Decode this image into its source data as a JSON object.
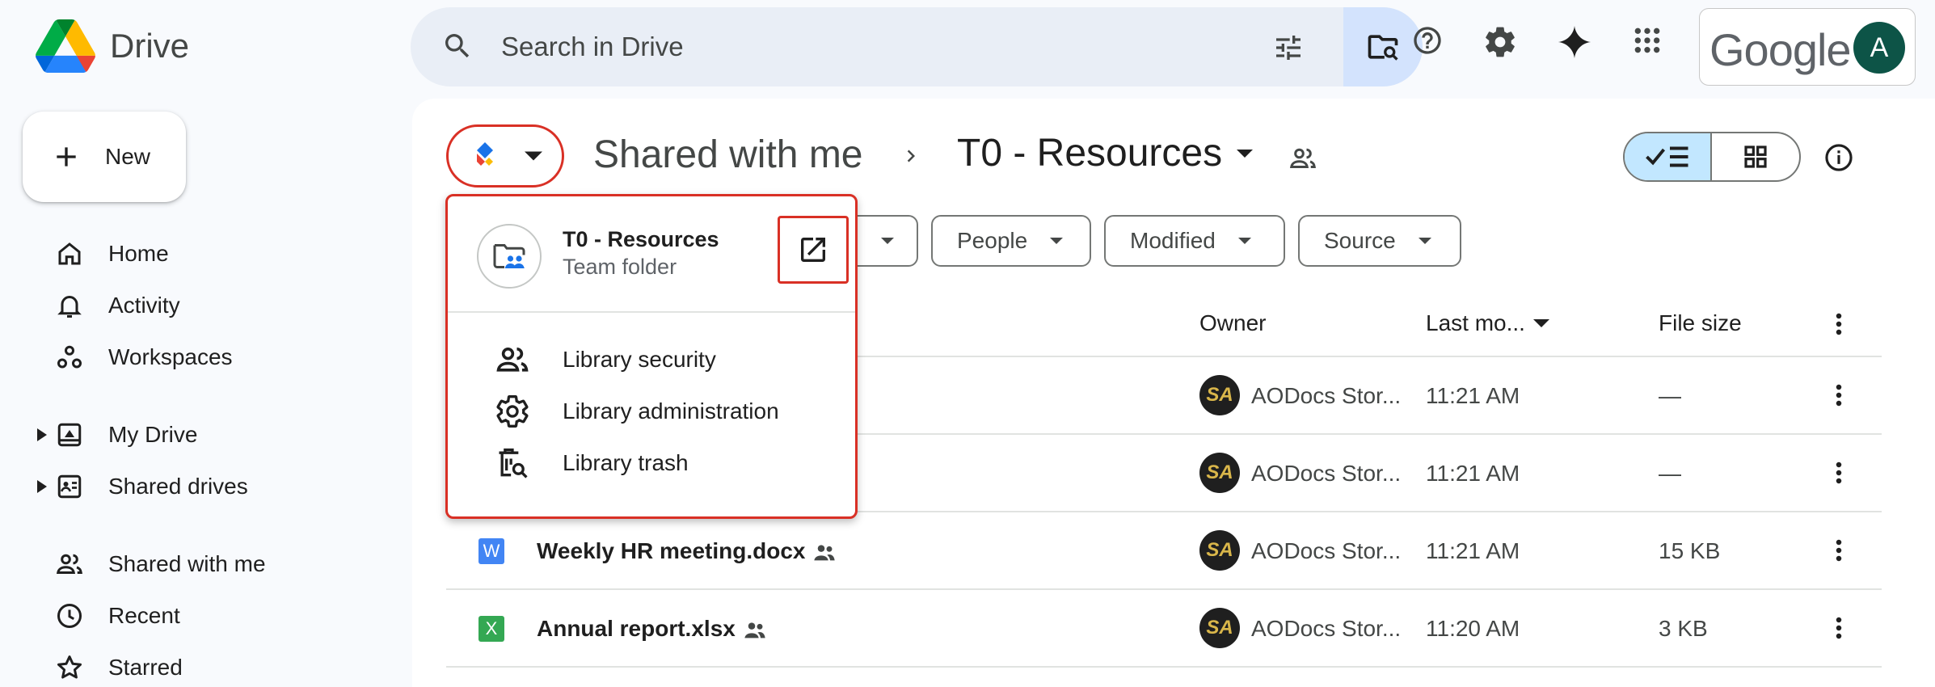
{
  "app": {
    "name": "Drive"
  },
  "search": {
    "placeholder": "Search in Drive"
  },
  "account": {
    "brand": "Google",
    "avatar_letter": "A"
  },
  "sidebar": {
    "new_label": "New",
    "items": [
      {
        "label": "Home",
        "icon": "home-icon"
      },
      {
        "label": "Activity",
        "icon": "bell-icon"
      },
      {
        "label": "Workspaces",
        "icon": "workspaces-icon"
      },
      {
        "label": "My Drive",
        "icon": "my-drive-icon"
      },
      {
        "label": "Shared drives",
        "icon": "shared-drives-icon"
      },
      {
        "label": "Shared with me",
        "icon": "people-icon"
      },
      {
        "label": "Recent",
        "icon": "clock-icon"
      },
      {
        "label": "Starred",
        "icon": "star-icon"
      }
    ]
  },
  "breadcrumb": {
    "parent": "Shared with me",
    "current": "T0 - Resources"
  },
  "filters": {
    "people": "People",
    "modified": "Modified",
    "source": "Source"
  },
  "table": {
    "headers": {
      "owner": "Owner",
      "last_modified": "Last mo...",
      "file_size": "File size"
    },
    "rows": [
      {
        "name": "",
        "owner": "AODocs Stor...",
        "modified": "11:21 AM",
        "size": "—"
      },
      {
        "name": "",
        "owner": "AODocs Stor...",
        "modified": "11:21 AM",
        "size": "—"
      },
      {
        "name": "Weekly HR meeting.docx",
        "type_letter": "W",
        "owner": "AODocs Stor...",
        "modified": "11:21 AM",
        "size": "15 KB"
      },
      {
        "name": "Annual report.xlsx",
        "type_letter": "X",
        "owner": "AODocs Stor...",
        "modified": "11:20 AM",
        "size": "3 KB"
      }
    ],
    "owner_avatar_text": "SA"
  },
  "popup": {
    "title": "T0 - Resources",
    "subtitle": "Team folder",
    "items": [
      {
        "label": "Library security",
        "icon": "people-icon"
      },
      {
        "label": "Library administration",
        "icon": "gear-icon"
      },
      {
        "label": "Library trash",
        "icon": "trash-search-icon"
      }
    ]
  },
  "colors": {
    "accent": "#0b57d0",
    "highlight": "#d93025",
    "selected": "#c2e7ff",
    "search_bg": "#e9eef6"
  }
}
